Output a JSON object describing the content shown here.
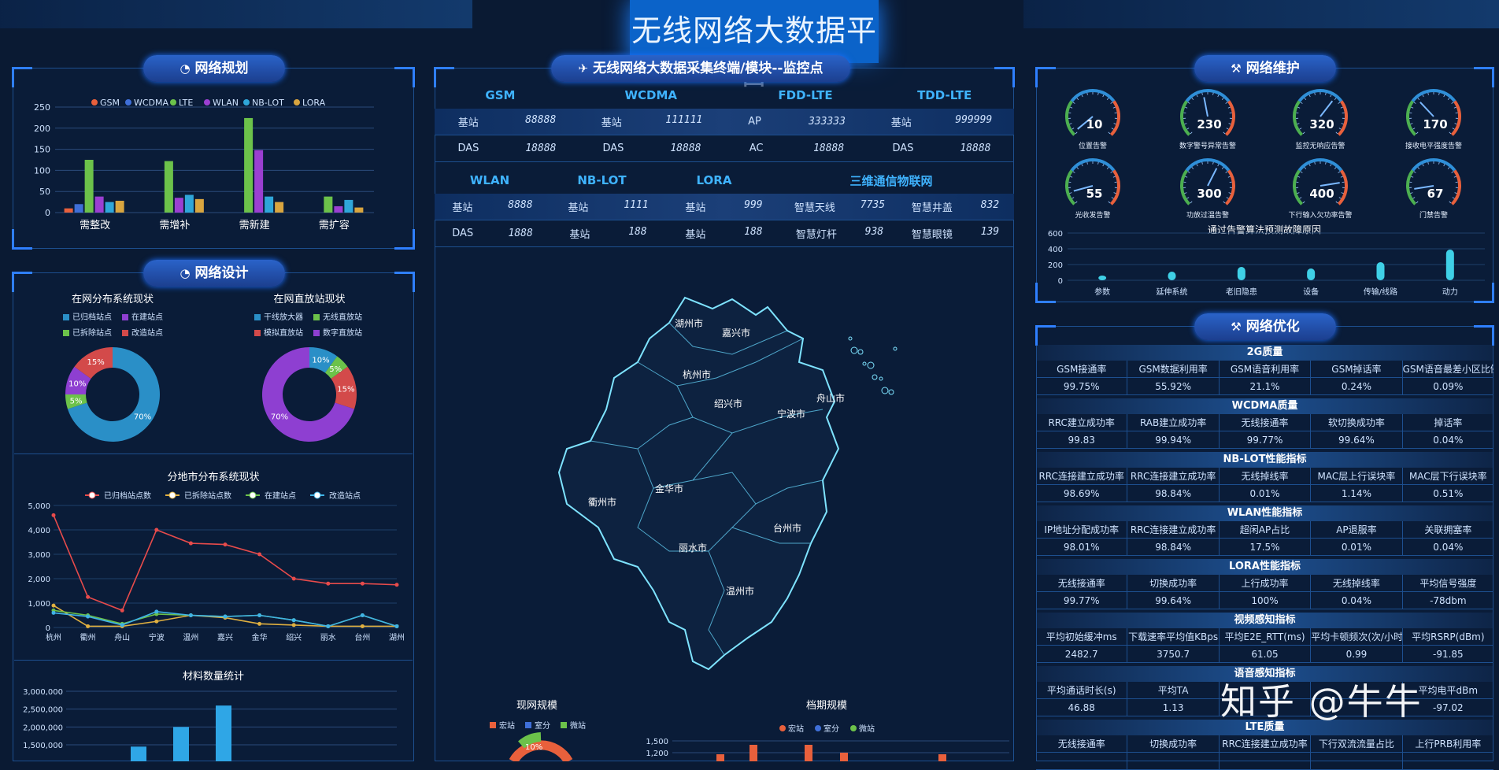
{
  "title": "无线网络大数据平台",
  "colors": {
    "accent": "#2f7fff",
    "bg": "#0a1a33",
    "gsm": "#e8603c",
    "wcdma": "#3f6fd8",
    "lte": "#6cc24a",
    "wlan": "#9b3fd1",
    "nblot": "#2fa6d9",
    "lora": "#d9a53f"
  },
  "watermark": "知乎 @牛牛",
  "panels": {
    "planning": {
      "title": "网络规划",
      "icon": "pie-icon"
    },
    "design": {
      "title": "网络设计",
      "icon": "pie-icon"
    },
    "center": {
      "title": "无线网络大数据采集终端/模块--监控点",
      "icon": "bird-icon"
    },
    "maintenance": {
      "title": "网络维护",
      "icon": "tool-icon"
    },
    "optimization": {
      "title": "网络优化",
      "icon": "tool-icon"
    }
  },
  "chart_data": [
    {
      "id": "planning",
      "type": "bar",
      "legend": [
        "GSM",
        "WCDMA",
        "LTE",
        "WLAN",
        "NB-LOT",
        "LORA"
      ],
      "categories": [
        "需整改",
        "需增补",
        "需新建",
        "需扩容"
      ],
      "ylim": [
        0,
        250
      ],
      "yticks": [
        "0",
        "50",
        "100",
        "150",
        "200",
        "250"
      ],
      "series": [
        {
          "name": "GSM",
          "values": [
            10,
            0,
            0,
            0
          ]
        },
        {
          "name": "WCDMA",
          "values": [
            20,
            0,
            0,
            0
          ]
        },
        {
          "name": "LTE",
          "values": [
            125,
            122,
            224,
            38
          ]
        },
        {
          "name": "WLAN",
          "values": [
            38,
            35,
            148,
            15
          ]
        },
        {
          "name": "NB-LOT",
          "values": [
            25,
            42,
            38,
            30
          ]
        },
        {
          "name": "LORA",
          "values": [
            28,
            32,
            25,
            12
          ]
        }
      ]
    },
    {
      "id": "donut-dist",
      "type": "pie",
      "title": "在网分布系统现状",
      "legend": [
        "已归档站点",
        "在建站点",
        "已拆除站点",
        "改造站点"
      ],
      "slices": [
        {
          "label": "已归档站点",
          "value": 70,
          "text": "70%"
        },
        {
          "label": "已拆除站点",
          "value": 5,
          "text": "5%"
        },
        {
          "label": "在建站点",
          "value": 10,
          "text": "10%"
        },
        {
          "label": "改造站点",
          "value": 15,
          "text": "15%"
        }
      ]
    },
    {
      "id": "donut-repeater",
      "type": "pie",
      "title": "在网直放站现状",
      "legend": [
        "干线放大器",
        "无线直放站",
        "模拟直放站",
        "数字直放站"
      ],
      "slices": [
        {
          "label": "干线放大器",
          "value": 10,
          "text": "10%"
        },
        {
          "label": "无线直放站",
          "value": 5,
          "text": "5%"
        },
        {
          "label": "模拟直放站",
          "value": 15,
          "text": "15%"
        },
        {
          "label": "数字直放站",
          "value": 70,
          "text": "70%"
        }
      ]
    },
    {
      "id": "city-lines",
      "type": "line",
      "title": "分地市分布系统现状",
      "categories": [
        "杭州",
        "衢州",
        "舟山",
        "宁波",
        "温州",
        "嘉兴",
        "金华",
        "绍兴",
        "丽水",
        "台州",
        "湖州"
      ],
      "ylim": [
        0,
        5000
      ],
      "yticks": [
        "0",
        "1,000",
        "2,000",
        "3,000",
        "4,000",
        "5,000"
      ],
      "series": [
        {
          "name": "已归档站点数",
          "values": [
            4600,
            1250,
            700,
            4000,
            3450,
            3400,
            3000,
            2000,
            1800,
            1800,
            1750
          ]
        },
        {
          "name": "已拆除站点数",
          "values": [
            900,
            50,
            50,
            250,
            500,
            400,
            150,
            100,
            50,
            50,
            50
          ]
        },
        {
          "name": "在建站点",
          "values": [
            700,
            500,
            150,
            550,
            500,
            450,
            500,
            300,
            50,
            500,
            50
          ]
        },
        {
          "name": "改造站点",
          "values": [
            600,
            450,
            100,
            650,
            500,
            450,
            500,
            300,
            50,
            500,
            50
          ]
        }
      ]
    },
    {
      "id": "materials",
      "type": "bar",
      "title": "材料数量统计",
      "yticks": [
        "1,500,000",
        "2,000,000",
        "2,500,000",
        "3,000,000"
      ],
      "ylim": [
        1500000,
        3000000
      ],
      "values": [
        1450000,
        2000000,
        2600000
      ]
    },
    {
      "id": "current-scale",
      "type": "pie",
      "title": "现网规模",
      "legend": [
        "宏站",
        "室分",
        "微站"
      ],
      "slices": [
        {
          "label": "微站",
          "value": 10,
          "text": "10%"
        }
      ]
    },
    {
      "id": "archive-scale",
      "type": "bar",
      "title": "档期规模",
      "legend": [
        "宏站",
        "室分",
        "微站"
      ],
      "yticks": [
        "1,200",
        "1,500"
      ]
    },
    {
      "id": "fault-reason",
      "type": "bar",
      "title": "通过告警算法预测故障原因",
      "categories": [
        "参数",
        "延伸系统",
        "老旧隐患",
        "设备",
        "传输/线路",
        "动力"
      ],
      "ylim": [
        0,
        600
      ],
      "yticks": [
        "0",
        "200",
        "400",
        "600"
      ],
      "values": [
        60,
        110,
        170,
        150,
        230,
        390
      ]
    }
  ],
  "gauges": [
    {
      "value": "10",
      "label": "位置告警"
    },
    {
      "value": "230",
      "label": "数字警号异常告警"
    },
    {
      "value": "320",
      "label": "监控无响应告警"
    },
    {
      "value": "170",
      "label": "接收电平强度告警"
    },
    {
      "value": "55",
      "label": "光收发告警"
    },
    {
      "value": "300",
      "label": "功放过温告警"
    },
    {
      "value": "400",
      "label": "下行输入欠功率告警"
    },
    {
      "value": "67",
      "label": "门禁告警"
    }
  ],
  "center_table": {
    "head1": [
      "GSM",
      "WCDMA",
      "FDD-LTE",
      "TDD-LTE"
    ],
    "row1": [
      [
        "基站",
        "88888"
      ],
      [
        "基站",
        "111111"
      ],
      [
        "AP",
        "333333"
      ],
      [
        "基站",
        "999999"
      ]
    ],
    "row2": [
      [
        "DAS",
        "18888"
      ],
      [
        "DAS",
        "18888"
      ],
      [
        "AC",
        "18888"
      ],
      [
        "DAS",
        "18888"
      ]
    ],
    "head2": [
      "WLAN",
      "NB-LOT",
      "LORA",
      "三维通信物联网"
    ],
    "row3": [
      [
        "基站",
        "8888"
      ],
      [
        "基站",
        "1111"
      ],
      [
        "基站",
        "999"
      ],
      [
        "智慧天线",
        "7735"
      ],
      [
        "智慧井盖",
        "832"
      ]
    ],
    "row4": [
      [
        "DAS",
        "1888"
      ],
      [
        "基站",
        "188"
      ],
      [
        "基站",
        "188"
      ],
      [
        "智慧灯杆",
        "938"
      ],
      [
        "智慧眼镜",
        "139"
      ]
    ]
  },
  "map_cities": [
    "湖州市",
    "嘉兴市",
    "杭州市",
    "绍兴市",
    "宁波市",
    "舟山市",
    "衢州市",
    "金华市",
    "台州市",
    "丽水市",
    "温州市"
  ],
  "optimization": [
    {
      "title": "2G质量",
      "cols": [
        "GSM接通率",
        "GSM数据利用率",
        "GSM语音利用率",
        "GSM掉话率",
        "GSM语音最差小区比例"
      ],
      "vals": [
        "99.75%",
        "55.92%",
        "21.1%",
        "0.24%",
        "0.09%"
      ]
    },
    {
      "title": "WCDMA质量",
      "cols": [
        "RRC建立成功率",
        "RAB建立成功率",
        "无线接通率",
        "软切换成功率",
        "掉话率"
      ],
      "vals": [
        "99.83",
        "99.94%",
        "99.77%",
        "99.64%",
        "0.04%"
      ]
    },
    {
      "title": "NB-LOT性能指标",
      "cols": [
        "RRC连接建立成功率",
        "RRC连接建立成功率",
        "无线掉线率",
        "MAC层上行误块率",
        "MAC层下行误块率"
      ],
      "vals": [
        "98.69%",
        "98.84%",
        "0.01%",
        "1.14%",
        "0.51%"
      ]
    },
    {
      "title": "WLAN性能指标",
      "cols": [
        "IP地址分配成功率",
        "RRC连接建立成功率",
        "超闲AP占比",
        "AP退服率",
        "关联拥塞率"
      ],
      "vals": [
        "98.01%",
        "98.84%",
        "17.5%",
        "0.01%",
        "0.04%"
      ]
    },
    {
      "title": "LORA性能指标",
      "cols": [
        "无线接通率",
        "切换成功率",
        "上行成功率",
        "无线掉线率",
        "平均信号强度"
      ],
      "vals": [
        "99.77%",
        "99.64%",
        "100%",
        "0.04%",
        "-78dbm"
      ]
    },
    {
      "title": "视频感知指标",
      "cols": [
        "平均初始缓冲ms",
        "下载速率平均值KBps",
        "平均E2E_RTT(ms)",
        "平均卡顿频次(次/小时)",
        "平均RSRP(dBm)"
      ],
      "vals": [
        "2482.7",
        "3750.7",
        "61.05",
        "0.99",
        "-91.85"
      ]
    },
    {
      "title": "语音感知指标",
      "cols": [
        "平均通话时长(s)",
        "平均TA",
        "",
        "",
        "平均电平dBm"
      ],
      "vals": [
        "46.88",
        "1.13",
        "",
        "",
        "-97.02"
      ]
    },
    {
      "title": "LTE质量",
      "cols": [
        "无线接通率",
        "切换成功率",
        "RRC连接建立成功率",
        "下行双流流量占比",
        "上行PRB利用率"
      ],
      "vals": [
        "",
        "",
        "",
        "",
        ""
      ]
    }
  ]
}
